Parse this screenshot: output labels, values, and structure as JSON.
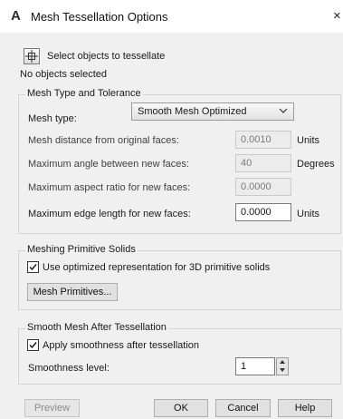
{
  "window": {
    "title": "Mesh Tessellation Options",
    "app_icon": "autocad-logo-icon",
    "close_glyph": "×"
  },
  "selection": {
    "button_icon": "select-objects-icon",
    "label": "Select objects to tessellate",
    "status": "No objects selected"
  },
  "mesh_type_tolerance": {
    "legend": "Mesh Type and Tolerance",
    "mesh_type_label": "Mesh type:",
    "mesh_type_value": "Smooth Mesh Optimized",
    "distance_label": "Mesh distance from original faces:",
    "distance_value": "0.0010",
    "distance_unit": "Units",
    "angle_label": "Maximum angle between new faces:",
    "angle_value": "40",
    "angle_unit": "Degrees",
    "aspect_label": "Maximum aspect ratio for new faces:",
    "aspect_value": "0.0000",
    "edge_label": "Maximum edge length for new faces:",
    "edge_value": "0.0000",
    "edge_unit": "Units"
  },
  "primitive_solids": {
    "legend": "Meshing Primitive Solids",
    "checkbox_label": "Use optimized representation for 3D primitive solids",
    "checked": true,
    "button_label": "Mesh Primitives..."
  },
  "smooth_mesh": {
    "legend": "Smooth Mesh After Tessellation",
    "checkbox_label": "Apply smoothness after tessellation",
    "checked": true,
    "level_label": "Smoothness level:",
    "level_value": "1"
  },
  "footer": {
    "preview_label": "Preview",
    "ok_label": "OK",
    "cancel_label": "Cancel",
    "help_label": "Help"
  },
  "colors": {
    "dialog_bg": "#f0f0f0",
    "titlebar_bg": "#ffffff",
    "group_border": "#d4d4d4"
  }
}
